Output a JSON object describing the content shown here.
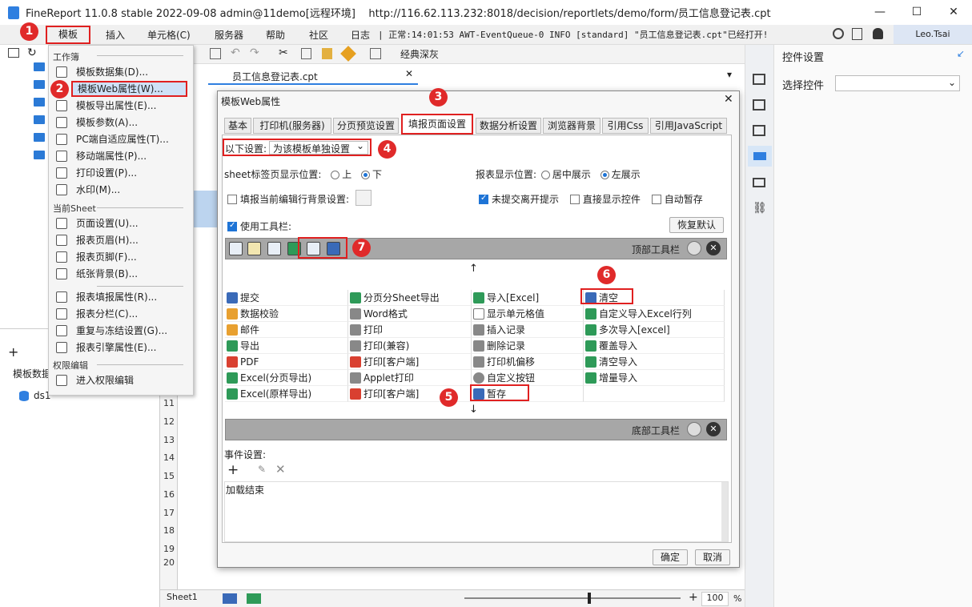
{
  "window": {
    "title": "FineReport 11.0.8 stable 2022-09-08 admin@11demo[远程环境]    http://116.62.113.232:8018/decision/reportlets/demo/form/员工信息登记表.cpt",
    "min": "—",
    "max": "☐",
    "close": "✕"
  },
  "menubar": {
    "items": [
      "模板",
      "插入",
      "单元格(C)",
      "服务器",
      "帮助",
      "社区",
      "日志"
    ],
    "log": "| 正常:14:01:53 AWT-EventQueue-0 INFO [standard] \"员工信息登记表.cpt\"已经打开!",
    "user": "Leo.Tsai"
  },
  "dropdown": {
    "workbook_header": "工作簿",
    "workbook_items": [
      "模板数据集(D)...",
      "模板Web属性(W)...",
      "模板导出属性(E)...",
      "模板参数(A)...",
      "PC端自适应属性(T)...",
      "移动端属性(P)...",
      "打印设置(P)...",
      "水印(M)..."
    ],
    "sheet_header": "当前Sheet",
    "sheet_items": [
      "页面设置(U)...",
      "报表页眉(H)...",
      "报表页脚(F)...",
      "纸张背景(B)..."
    ],
    "report_items": [
      "报表填报属性(R)...",
      "报表分栏(C)...",
      "重复与冻结设置(G)...",
      "报表引擎属性(E)..."
    ],
    "perm_header": "权限编辑",
    "perm_items": [
      "进入权限编辑"
    ]
  },
  "leftpanel": {
    "ds_header": "模板数据",
    "ds_item": "ds1"
  },
  "editor": {
    "toolbar_label": "经典深灰",
    "file_tab": "员工信息登记表.cpt",
    "row_numbers": [
      "11",
      "12",
      "13",
      "14",
      "15",
      "16",
      "17",
      "18",
      "19",
      "20"
    ],
    "sheet_tab": "Sheet1",
    "zoom": "100",
    "zoom_unit": "%",
    "tab_hint": "渠"
  },
  "rightpanel": {
    "title": "控件设置",
    "select_label": "选择控件",
    "select_value": ""
  },
  "dialog": {
    "title": "模板Web属性",
    "tabs": [
      "基本",
      "打印机(服务器)",
      "分页预览设置",
      "填报页面设置",
      "数据分析设置",
      "浏览器背景",
      "引用Css",
      "引用JavaScript"
    ],
    "settings_label": "以下设置:",
    "settings_value": "为该模板单独设置",
    "sheet_pos_label": "sheet标签页显示位置:",
    "sheet_pos_opts": [
      "上",
      "下"
    ],
    "report_pos_label": "报表显示位置:",
    "report_pos_opts": [
      "居中展示",
      "左展示"
    ],
    "fill_bg": "填报当前编辑行背景设置:",
    "unsubmitted": "未提交离开提示",
    "show_widget": "直接显示控件",
    "autosave": "自动暂存",
    "use_toolbar": "使用工具栏:",
    "restore": "恢复默认",
    "top_bar": "顶部工具栏",
    "bottom_bar": "底部工具栏",
    "up_arrow": "↑",
    "down_arrow": "↓",
    "options": [
      [
        "提交",
        "分页分Sheet导出",
        "导入[Excel]",
        "清空"
      ],
      [
        "数据校验",
        "Word格式",
        "显示单元格值",
        "自定义导入Excel行列"
      ],
      [
        "邮件",
        "打印",
        "插入记录",
        "多次导入[excel]"
      ],
      [
        "导出",
        "打印(兼容)",
        "删除记录",
        "覆盖导入"
      ],
      [
        "PDF",
        "打印[客户端]",
        "打印机偏移",
        "清空导入"
      ],
      [
        "Excel(分页导出)",
        "Applet打印",
        "自定义按钮",
        "增量导入"
      ],
      [
        "Excel(原样导出)",
        "打印[客户端]",
        "暂存",
        ""
      ]
    ],
    "event_label": "事件设置:",
    "event_item": "加载结束",
    "ok": "确定",
    "cancel": "取消"
  },
  "badges": [
    "1",
    "2",
    "3",
    "4",
    "5",
    "6",
    "7"
  ]
}
